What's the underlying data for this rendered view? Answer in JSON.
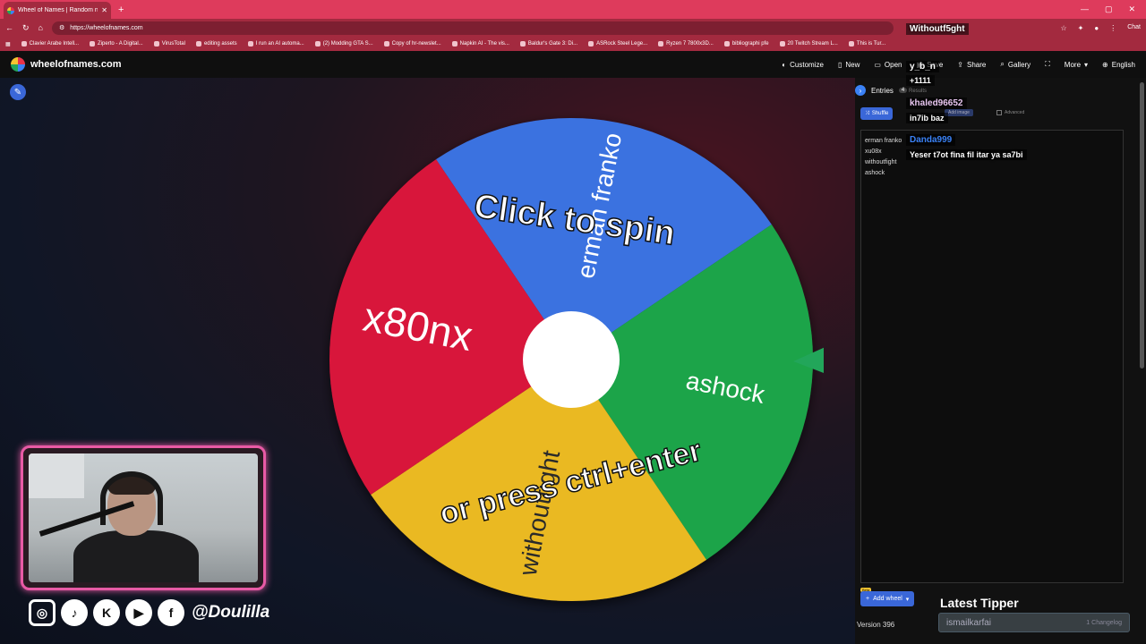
{
  "browser": {
    "tab_title": "Wheel of Names | Random name ...",
    "url": "https://wheelofnames.com",
    "chat_label": "Chat",
    "bookmarks": [
      "Clavier Arabe Intell...",
      "Ziperto - A Digital...",
      "VirusTotal",
      "editing assets",
      "I run an AI automa...",
      "(2) Modding GTA S...",
      "Copy of hr-newslet...",
      "Napkin AI - The vis...",
      "Baldur's Gate 3: Di...",
      "ASRock Steel Lege...",
      "Ryzen 7 7800x3D...",
      "bibliographi pfe",
      "20 Twitch Stream L...",
      "This is Tur..."
    ]
  },
  "appbar": {
    "site": "wheelofnames.com",
    "nav": [
      "Customize",
      "New",
      "Open",
      "Save",
      "Share",
      "Gallery",
      "",
      "More",
      "English"
    ],
    "nav_icons": [
      "palette-icon",
      "file-icon",
      "folder-icon",
      "save-icon",
      "share-icon",
      "search-icon",
      "fullscreen-icon",
      "more-icon",
      "globe-icon"
    ]
  },
  "wheel": {
    "segments": [
      {
        "label": "erman franko",
        "color": "#3b72e0"
      },
      {
        "label": "ashock",
        "color": "#1ea449"
      },
      {
        "label": "withoutfight",
        "color": "#eab924"
      },
      {
        "label": "x80nx",
        "color": "#d8163a"
      }
    ],
    "overlay_top": "Click to spin",
    "overlay_bottom": "or press ctrl+enter"
  },
  "panel": {
    "entries_label": "Entries",
    "entries_count": "4",
    "results_label": "Results",
    "shuffle_label": "Shuffle",
    "add_image_label": "Add image",
    "advanced_label": "Advanced",
    "entries": [
      "erman franko",
      "xu08x",
      "withoutfight",
      "ashock"
    ],
    "add_wheel_label": "Add wheel",
    "beta_label": "Beta",
    "version": "Version 396"
  },
  "chat": [
    {
      "type": "user",
      "text": "Withoutf5ght",
      "color": "#ffffff"
    },
    {
      "type": "user",
      "text": "y_b_n",
      "color": "#ffffff"
    },
    {
      "type": "msg",
      "text": "+1111"
    },
    {
      "type": "user",
      "text": "khaled96652",
      "color": "#e8c6f0"
    },
    {
      "type": "msg",
      "text": "in7ib baz"
    },
    {
      "type": "user",
      "text": "Danda999",
      "color": "#3b82f6"
    },
    {
      "type": "msg",
      "text": "Yeser t7ot fina fil itar ya sa7bi"
    }
  ],
  "tipper": {
    "title": "Latest Tipper",
    "name": "ismailkarfai",
    "amount": "1 Changelog"
  },
  "socials": {
    "icons": [
      "instagram-icon",
      "tiktok-icon",
      "kick-icon",
      "youtube-icon",
      "facebook-icon"
    ],
    "handle": "@Doulilla"
  }
}
